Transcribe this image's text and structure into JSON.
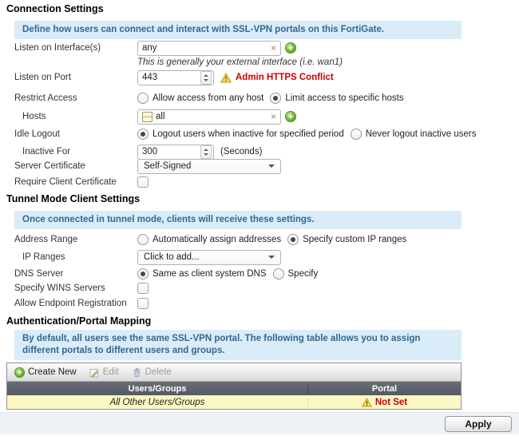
{
  "colors": {
    "info_bg": "#d9ecf7",
    "info_text": "#336791",
    "warning_red": "#cc0000",
    "table_header_bg": "#5a616b",
    "row_highlight": "#fcf8c5",
    "green_accent": "#61ad33",
    "footer_bg": "#eef1f6"
  },
  "icons": {
    "add": "+",
    "remove": "×"
  },
  "connection": {
    "title": "Connection Settings",
    "info": "Define how users can connect and interact with SSL-VPN portals on this FortiGate.",
    "listen_interfaces": {
      "label": "Listen on Interface(s)",
      "value": "any",
      "note": "This is generally your external interface (i.e. wan1)"
    },
    "listen_port": {
      "label": "Listen on Port",
      "value": "443",
      "warning": "Admin HTTPS Conflict"
    },
    "restrict_access": {
      "label": "Restrict Access",
      "option_any": "Allow access from any host",
      "option_limit": "Limit access to specific hosts",
      "selected": "limit"
    },
    "hosts": {
      "label": "Hosts",
      "value": "all"
    },
    "idle_logout": {
      "label": "Idle Logout",
      "option_logout": "Logout users when inactive for specified period",
      "option_never": "Never logout inactive users",
      "selected": "logout"
    },
    "inactive_for": {
      "label": "Inactive For",
      "value": "300",
      "suffix": "(Seconds)"
    },
    "server_certificate": {
      "label": "Server Certificate",
      "value": "Self-Signed"
    },
    "require_client_certificate": {
      "label": "Require Client Certificate",
      "checked": false
    }
  },
  "tunnel": {
    "title": "Tunnel Mode Client Settings",
    "info": "Once connected in tunnel mode, clients will receive these settings.",
    "address_range": {
      "label": "Address Range",
      "option_auto": "Automatically assign addresses",
      "option_custom": "Specify custom IP ranges",
      "selected": "custom"
    },
    "ip_ranges": {
      "label": "IP Ranges",
      "value": "Click to add..."
    },
    "dns_server": {
      "label": "DNS Server",
      "option_same": "Same as client system DNS",
      "option_specify": "Specify",
      "selected": "same"
    },
    "specify_wins": {
      "label": "Specify WINS Servers",
      "checked": false
    },
    "endpoint_registration": {
      "label": "Allow Endpoint Registration",
      "checked": false
    }
  },
  "portal_mapping": {
    "title": "Authentication/Portal Mapping",
    "info": "By default, all users see the same SSL-VPN portal. The following table allows you to assign different portals to different users and groups.",
    "toolbar": {
      "create": "Create New",
      "edit": "Edit",
      "delete": "Delete"
    },
    "table": {
      "headers": [
        "Users/Groups",
        "Portal"
      ],
      "rows": [
        {
          "users_groups": "All Other Users/Groups",
          "portal": "Not Set"
        }
      ]
    }
  },
  "footer": {
    "apply_label": "Apply"
  }
}
